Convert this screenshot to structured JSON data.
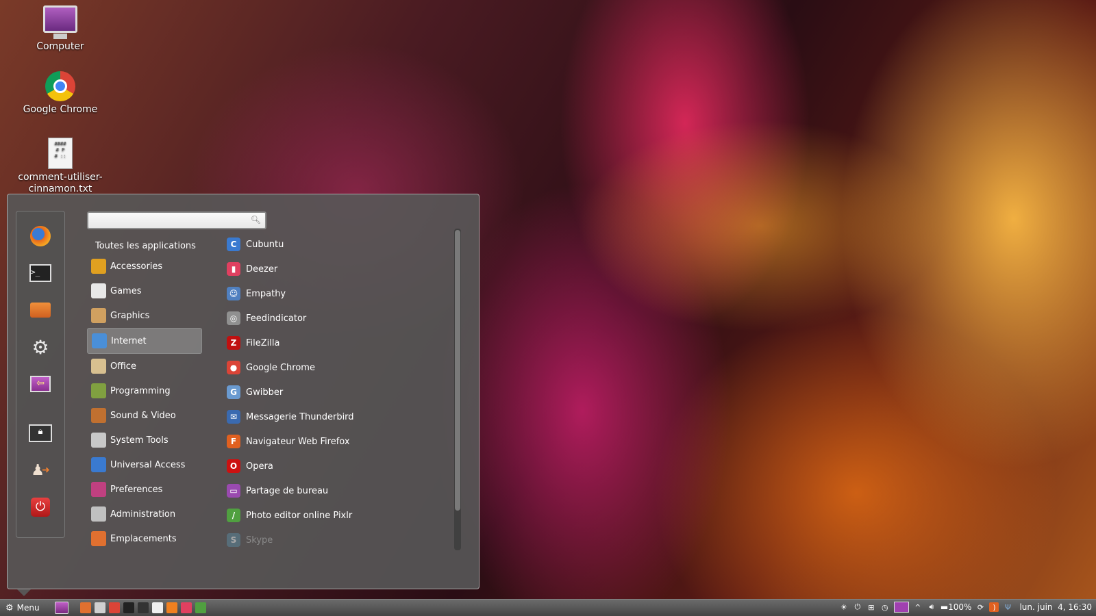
{
  "desktop": {
    "icons": [
      {
        "label": "Computer",
        "icon": "computer-icon"
      },
      {
        "label": "Google Chrome",
        "icon": "google-chrome-icon"
      },
      {
        "label": "comment-utiliser-cinnamon.txt",
        "icon": "text-file-icon"
      }
    ]
  },
  "menu": {
    "search": {
      "value": "",
      "placeholder": ""
    },
    "all_apps_label": "Toutes les applications",
    "favorites": [
      {
        "icon": "firefox-icon"
      },
      {
        "icon": "terminal-icon"
      },
      {
        "icon": "home-folder-icon"
      },
      {
        "icon": "settings-icon"
      },
      {
        "icon": "screen-sharing-icon"
      },
      {
        "icon": "lock-screen-icon"
      },
      {
        "icon": "logout-icon"
      },
      {
        "icon": "power-icon"
      }
    ],
    "categories": [
      {
        "label": "Accessories",
        "color": "#e0a020"
      },
      {
        "label": "Games",
        "color": "#e8e8e8"
      },
      {
        "label": "Graphics",
        "color": "#d0a060"
      },
      {
        "label": "Internet",
        "color": "#4a8fd8",
        "active": true
      },
      {
        "label": "Office",
        "color": "#d8c090"
      },
      {
        "label": "Programming",
        "color": "#80a040"
      },
      {
        "label": "Sound & Video",
        "color": "#c07030"
      },
      {
        "label": "System Tools",
        "color": "#c8c8c8"
      },
      {
        "label": "Universal Access",
        "color": "#3a7ad0"
      },
      {
        "label": "Preferences",
        "color": "#c04080"
      },
      {
        "label": "Administration",
        "color": "#c0c0c0"
      },
      {
        "label": "Emplacements",
        "color": "#e07030"
      }
    ],
    "apps": [
      {
        "label": "Cubuntu",
        "color": "#3a7ad0",
        "glyph": "C"
      },
      {
        "label": "Deezer",
        "color": "#e04060",
        "glyph": "▮"
      },
      {
        "label": "Empathy",
        "color": "#5080c0",
        "glyph": "☺"
      },
      {
        "label": "Feedindicator",
        "color": "#909090",
        "glyph": "◎"
      },
      {
        "label": "FileZilla",
        "color": "#c01010",
        "glyph": "Z"
      },
      {
        "label": "Google Chrome",
        "color": "#db4437",
        "glyph": "●"
      },
      {
        "label": "Gwibber",
        "color": "#6a9ad0",
        "glyph": "G"
      },
      {
        "label": "Messagerie Thunderbird",
        "color": "#3a6ab0",
        "glyph": "✉"
      },
      {
        "label": "Navigateur Web Firefox",
        "color": "#e06020",
        "glyph": "F"
      },
      {
        "label": "Opera",
        "color": "#cc1111",
        "glyph": "O"
      },
      {
        "label": "Partage de bureau",
        "color": "#9a4ab0",
        "glyph": "▭"
      },
      {
        "label": "Photo editor online Pixlr",
        "color": "#50a040",
        "glyph": "/"
      },
      {
        "label": "Skype",
        "color": "#5a8aa0",
        "glyph": "S",
        "dim": true
      }
    ]
  },
  "panel": {
    "menu_label": "Menu",
    "launchers": [
      "files-icon",
      "settings-icon",
      "chrome-icon",
      "terminal-icon",
      "screenshot-icon",
      "document-icon",
      "vlc-icon",
      "deezer-icon",
      "pixlr-icon"
    ],
    "battery": "100%",
    "clock": "lun. juin  4, 16:30"
  }
}
